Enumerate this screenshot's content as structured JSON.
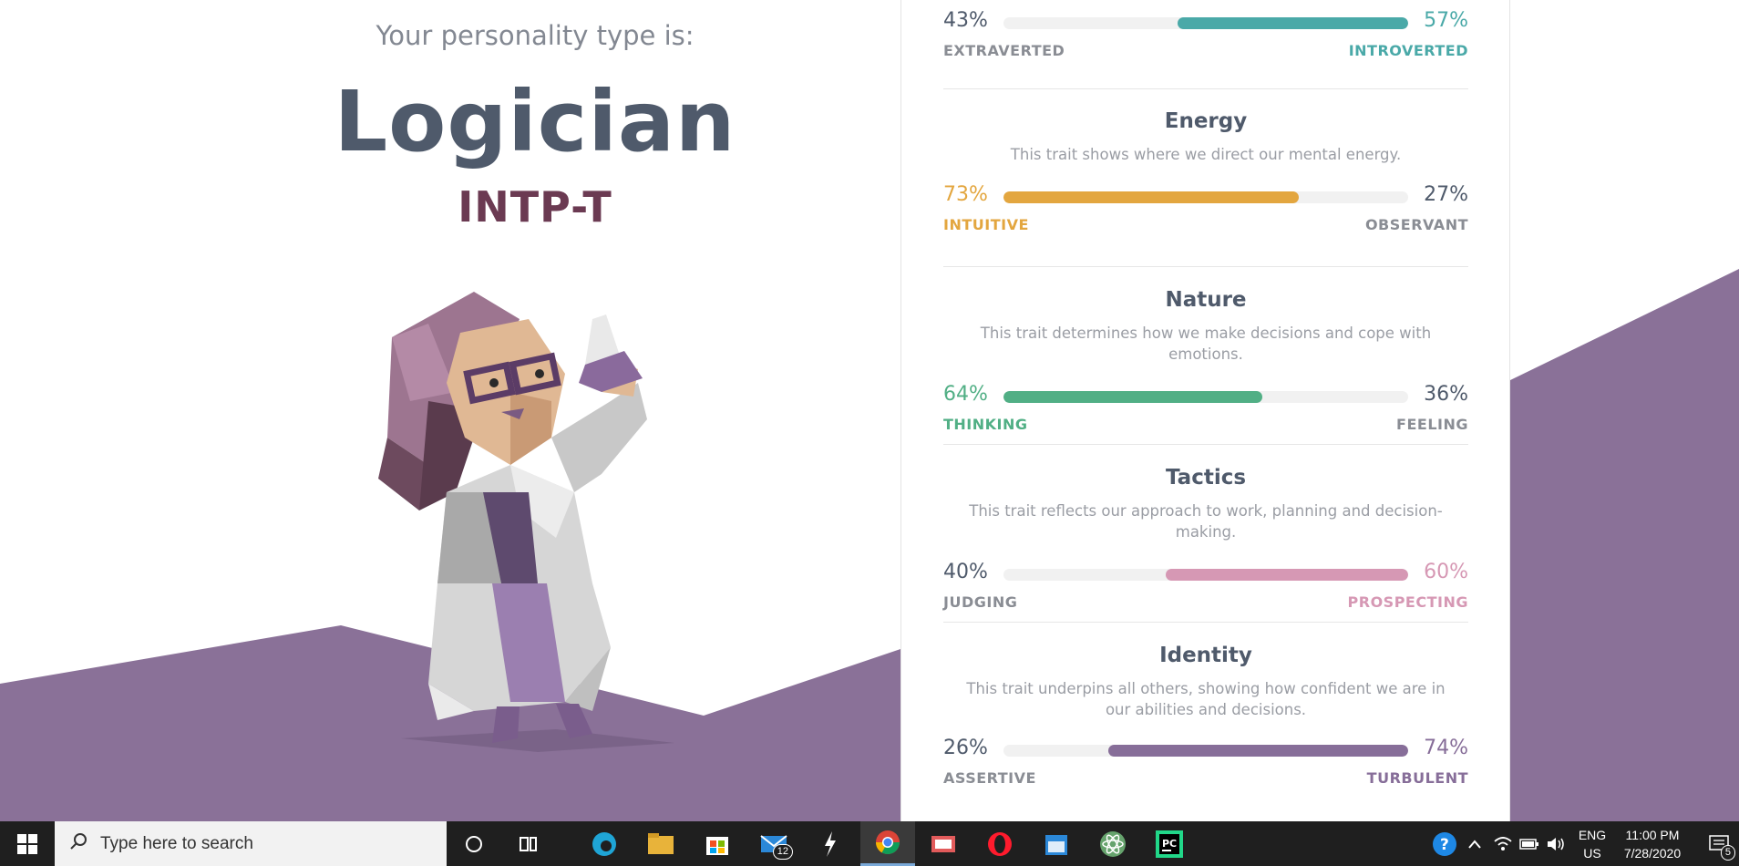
{
  "page": {
    "subtitle": "Your personality type is:",
    "type_name": "Logician",
    "type_code": "INTP-T"
  },
  "colors": {
    "purple_bg": "#8a7198",
    "teal": "#4aa9a8",
    "yellow": "#e3a63f",
    "green": "#51af85",
    "pink": "#d698b4",
    "purple": "#876e99",
    "text_dark": "#4f5a6b"
  },
  "traits": [
    {
      "title": "",
      "description": "",
      "left_pct": "43%",
      "right_pct": "57%",
      "left_label": "EXTRAVERTED",
      "right_label": "INTROVERTED",
      "dominant": "right",
      "dominant_fraction": 0.57,
      "color": "#4aa9a8"
    },
    {
      "title": "Energy",
      "description": "This trait shows where we direct our mental energy.",
      "left_pct": "73%",
      "right_pct": "27%",
      "left_label": "INTUITIVE",
      "right_label": "OBSERVANT",
      "dominant": "left",
      "dominant_fraction": 0.73,
      "color": "#e3a63f"
    },
    {
      "title": "Nature",
      "description": "This trait determines how we make decisions and cope with emotions.",
      "left_pct": "64%",
      "right_pct": "36%",
      "left_label": "THINKING",
      "right_label": "FEELING",
      "dominant": "left",
      "dominant_fraction": 0.64,
      "color": "#51af85"
    },
    {
      "title": "Tactics",
      "description": "This trait reflects our approach to work, planning and decision-making.",
      "left_pct": "40%",
      "right_pct": "60%",
      "left_label": "JUDGING",
      "right_label": "PROSPECTING",
      "dominant": "right",
      "dominant_fraction": 0.6,
      "color": "#d698b4"
    },
    {
      "title": "Identity",
      "description": "This trait underpins all others, showing how confident we are in our abilities and decisions.",
      "left_pct": "26%",
      "right_pct": "74%",
      "left_label": "ASSERTIVE",
      "right_label": "TURBULENT",
      "dominant": "right",
      "dominant_fraction": 0.74,
      "color": "#876e99"
    }
  ],
  "taskbar": {
    "search_placeholder": "Type here to search",
    "mail_badge": "12",
    "lang_top": "ENG",
    "lang_bottom": "US",
    "time": "11:00 PM",
    "date": "7/28/2020",
    "notification_count": "5",
    "icons": [
      "windows-start-icon",
      "search-icon",
      "cortana-icon",
      "task-view-icon",
      "edge-icon",
      "file-explorer-icon",
      "store-icon",
      "mail-icon",
      "app-icon",
      "chrome-icon",
      "snip-icon",
      "opera-icon",
      "calendar-icon",
      "atom-icon",
      "pycharm-icon",
      "help-icon",
      "chevron-up-icon",
      "wifi-icon",
      "battery-icon",
      "volume-icon",
      "notification-icon"
    ]
  }
}
